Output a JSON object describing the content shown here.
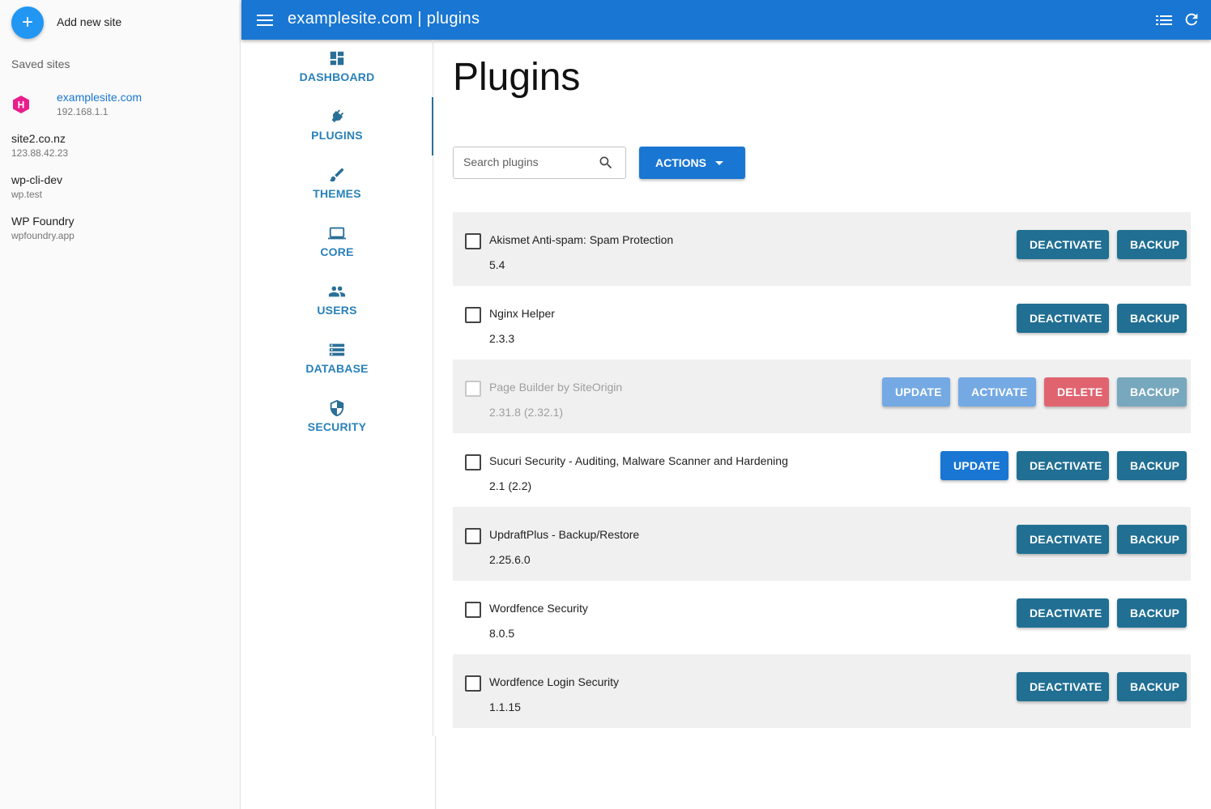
{
  "sidebar": {
    "add_label": "Add new site",
    "add_glyph": "+",
    "saved_title": "Saved sites",
    "sites": [
      {
        "name": "examplesite.com",
        "host": "192.168.1.1",
        "active": true,
        "logo_letter": "H",
        "logo_color": "#e91e8c"
      },
      {
        "name": "site2.co.nz",
        "host": "123.88.42.23"
      },
      {
        "name": "wp-cli-dev",
        "host": "wp.test"
      },
      {
        "name": "WP Foundry",
        "host": "wpfoundry.app"
      }
    ]
  },
  "appbar": {
    "title": "examplesite.com | plugins",
    "color": "#1976d2",
    "icons": [
      "menu-icon",
      "list-icon",
      "refresh-icon"
    ]
  },
  "nav": {
    "items": [
      {
        "label": "DASHBOARD",
        "icon": "dashboard-icon"
      },
      {
        "label": "PLUGINS",
        "icon": "plugin-icon",
        "active": true
      },
      {
        "label": "THEMES",
        "icon": "brush-icon"
      },
      {
        "label": "CORE",
        "icon": "laptop-icon"
      },
      {
        "label": "USERS",
        "icon": "users-icon"
      },
      {
        "label": "DATABASE",
        "icon": "database-icon"
      },
      {
        "label": "SECURITY",
        "icon": "shield-icon"
      }
    ]
  },
  "main": {
    "title": "Plugins",
    "search_placeholder": "Search plugins",
    "actions_label": "ACTIONS"
  },
  "labels": {
    "deactivate": "DEACTIVATE",
    "backup": "BACKUP",
    "update": "UPDATE",
    "activate": "ACTIVATE",
    "delete": "DELETE"
  },
  "plugins": [
    {
      "name": "Akismet Anti-spam: Spam Protection",
      "version": "5.4"
    },
    {
      "name": "Nginx Helper",
      "version": "2.3.3"
    },
    {
      "name": "Page Builder by SiteOrigin",
      "version": "2.31.8 (2.32.1)",
      "inactive": true
    },
    {
      "name": "Sucuri Security - Auditing, Malware Scanner and Hardening",
      "version": "2.1 (2.2)"
    },
    {
      "name": "UpdraftPlus - Backup/Restore",
      "version": "2.25.6.0"
    },
    {
      "name": "Wordfence Security",
      "version": "8.0.5"
    },
    {
      "name": "Wordfence Login Security",
      "version": "1.1.15"
    }
  ],
  "colors": {
    "primary": "#1976d2",
    "teal_button": "#216f93",
    "delete_button": "#e06470",
    "nav_label": "#2980b9"
  }
}
